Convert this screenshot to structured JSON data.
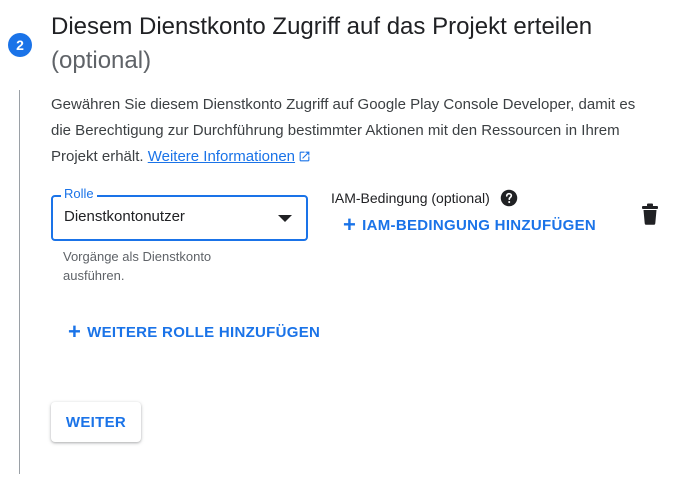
{
  "step": {
    "number": "2",
    "title": "Diesem Dienstkonto Zugriff auf das Projekt erteilen",
    "optional": "(optional)"
  },
  "description": {
    "text": "Gewähren Sie diesem Dienstkonto Zugriff auf Google Play Console Developer, damit es die Berechtigung zur Durchführung bestimmter Aktionen mit den Ressourcen in Ihrem Projekt erhält.",
    "link": "Weitere Informationen"
  },
  "role_field": {
    "label": "Rolle",
    "value": "Dienstkontonutzer",
    "hint": "Vorgänge als Dienstkonto ausführen."
  },
  "iam": {
    "label": "IAM-Bedingung (optional)",
    "add_button": "IAM-BEDINGUNG HINZUFÜGEN"
  },
  "add_role_button": "WEITERE ROLLE HINZUFÜGEN",
  "continue_button": "WEITER",
  "icons": {
    "external_link": "external-link-icon",
    "dropdown": "dropdown-arrow-icon",
    "help": "help-circle-icon",
    "delete": "trash-icon",
    "add": "plus-icon"
  },
  "colors": {
    "accent": "#1a73e8",
    "text": "#202124",
    "secondary": "#5f6368"
  }
}
